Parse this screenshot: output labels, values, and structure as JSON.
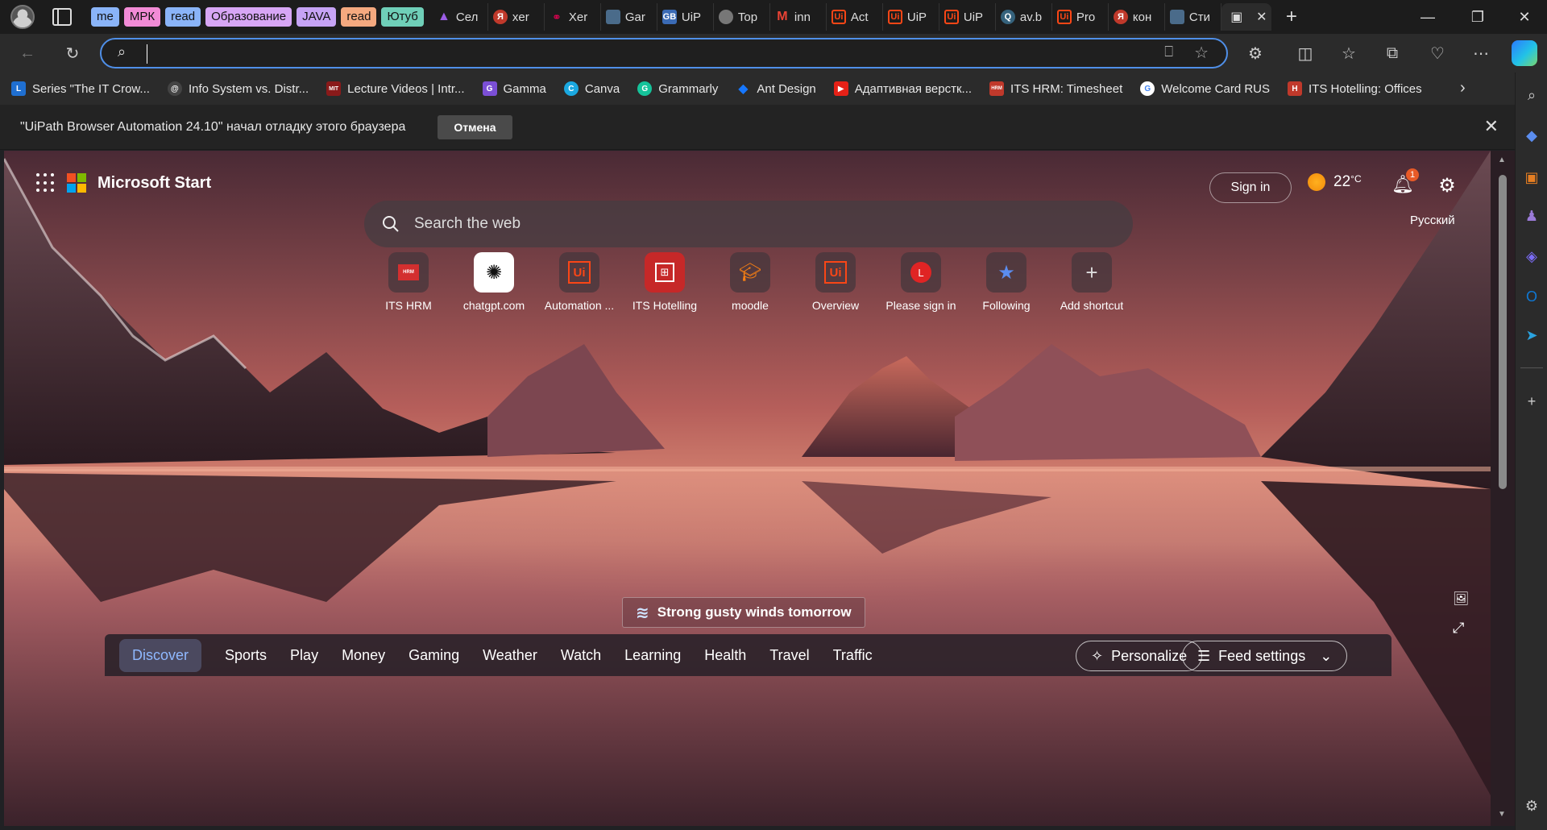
{
  "tab_groups": [
    {
      "label": "me",
      "color": "#8ab4f8"
    },
    {
      "label": "МРК",
      "color": "#f28bd6"
    },
    {
      "label": "read",
      "color": "#8ab4f8"
    },
    {
      "label": "Образование",
      "color": "#d7a6f5"
    },
    {
      "label": "JAVA",
      "color": "#c6a3f5"
    },
    {
      "label": "read",
      "color": "#f5a97f"
    },
    {
      "label": "Ютуб",
      "color": "#6fcfb8"
    }
  ],
  "tabs": [
    {
      "label": "Сел",
      "icon": "triangle-icon",
      "color": "#6a2ba1"
    },
    {
      "label": "xer",
      "icon": "yandex-icon",
      "color": "#c0392b"
    },
    {
      "label": "Xer",
      "icon": "link-icon",
      "color": "#b33"
    },
    {
      "label": "Gar",
      "icon": "page-icon",
      "color": "#4a6b8a"
    },
    {
      "label": "UiP",
      "icon": "gb-icon",
      "color": "#3b6bb5"
    },
    {
      "label": "Top",
      "icon": "globe-icon",
      "color": "#777"
    },
    {
      "label": "inn",
      "icon": "gmail-icon",
      "color": "#d93025"
    },
    {
      "label": "Act",
      "icon": "uipath-icon",
      "color": "#fa4616"
    },
    {
      "label": "UiP",
      "icon": "uipath-icon",
      "color": "#fa4616"
    },
    {
      "label": "UiP",
      "icon": "uipath-icon",
      "color": "#fa4616"
    },
    {
      "label": "av.b",
      "icon": "search-tab-icon",
      "color": "#35627c"
    },
    {
      "label": "Pro",
      "icon": "uipath-icon",
      "color": "#fa4616"
    },
    {
      "label": "кон",
      "icon": "yandex-icon",
      "color": "#c0392b"
    },
    {
      "label": "Сти",
      "icon": "page-icon",
      "color": "#4a6b8a"
    }
  ],
  "address": {
    "value": "",
    "placeholder": ""
  },
  "favorites": [
    {
      "label": "Series \"The IT Crow...",
      "icon": "L",
      "color": "#1f6fd1"
    },
    {
      "label": "Info System vs. Distr...",
      "icon": "@",
      "color": "#444"
    },
    {
      "label": "Lecture Videos | Intr...",
      "icon": "MIT",
      "color": "#8a1a1a"
    },
    {
      "label": "Gamma",
      "icon": "G",
      "color": "#7b4fd6"
    },
    {
      "label": "Canva",
      "icon": "C",
      "color": "#1aa8e0"
    },
    {
      "label": "Grammarly",
      "icon": "G",
      "color": "#15c39a"
    },
    {
      "label": "Ant Design",
      "icon": "◆",
      "color": "#1677ff"
    },
    {
      "label": "Адаптивная верстк...",
      "icon": "▶",
      "color": "#e62117"
    },
    {
      "label": "ITS HRM: Timesheet",
      "icon": "HRM",
      "color": "#c0392b"
    },
    {
      "label": "Welcome Card RUS",
      "icon": "G",
      "color": "#4285f4"
    },
    {
      "label": "ITS Hotelling: Offices",
      "icon": "H",
      "color": "#c0392b"
    }
  ],
  "infobar": {
    "message": "\"UiPath Browser Automation 24.10\" начал отладку этого браузера",
    "cancel_label": "Отмена"
  },
  "page": {
    "brand": "Microsoft Start",
    "signin_label": "Sign in",
    "temperature": "22",
    "temp_unit": "°C",
    "notifications_count": "1",
    "language": "Русский",
    "search_placeholder": "Search the web",
    "shortcuts": [
      {
        "label": "ITS HRM",
        "icon": "hrm-icon"
      },
      {
        "label": "chatgpt.com",
        "icon": "chatgpt-icon"
      },
      {
        "label": "Automation ...",
        "icon": "uipath-icon"
      },
      {
        "label": "ITS Hotelling",
        "icon": "hotelling-icon"
      },
      {
        "label": "moodle",
        "icon": "moodle-icon"
      },
      {
        "label": "Overview",
        "icon": "uipath-icon"
      },
      {
        "label": "Please sign in",
        "icon": "letter-l-icon"
      },
      {
        "label": "Following",
        "icon": "following-icon"
      },
      {
        "label": "Add shortcut",
        "icon": "plus-icon"
      }
    ],
    "weather_alert": "Strong gusty winds tomorrow",
    "feed_tabs": [
      "Discover",
      "Sports",
      "Play",
      "Money",
      "Gaming",
      "Weather",
      "Watch",
      "Learning",
      "Health",
      "Travel",
      "Traffic"
    ],
    "personalize_label": "Personalize",
    "feed_settings_label": "Feed settings"
  }
}
